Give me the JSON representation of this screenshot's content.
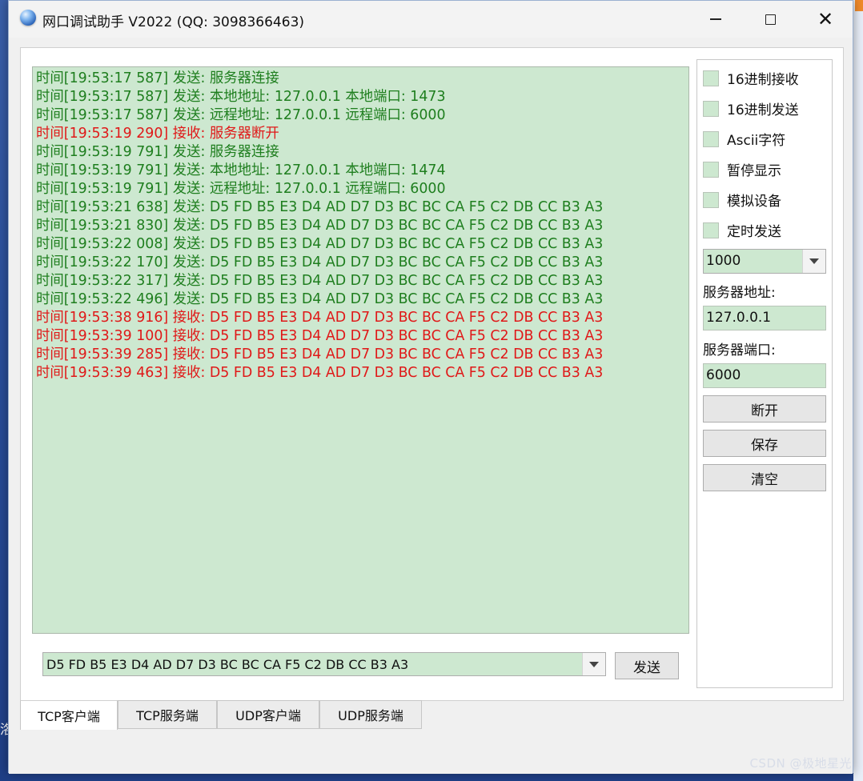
{
  "window": {
    "title": "网口调试助手 V2022 (QQ: 3098366463)",
    "minimize_icon": "minimize-icon",
    "maximize_icon": "maximize-icon",
    "close_icon": "close-icon",
    "close_glyph": "✕"
  },
  "log": [
    {
      "kind": "send",
      "text": "时间[19:53:17 587] 发送: 服务器连接"
    },
    {
      "kind": "send",
      "text": "时间[19:53:17 587] 发送: 本地地址: 127.0.0.1  本地端口: 1473"
    },
    {
      "kind": "send",
      "text": "时间[19:53:17 587] 发送: 远程地址: 127.0.0.1  远程端口: 6000"
    },
    {
      "kind": "recv",
      "text": "时间[19:53:19 290] 接收: 服务器断开"
    },
    {
      "kind": "send",
      "text": "时间[19:53:19 791] 发送: 服务器连接"
    },
    {
      "kind": "send",
      "text": "时间[19:53:19 791] 发送: 本地地址: 127.0.0.1  本地端口: 1474"
    },
    {
      "kind": "send",
      "text": "时间[19:53:19 791] 发送: 远程地址: 127.0.0.1  远程端口: 6000"
    },
    {
      "kind": "send",
      "text": "时间[19:53:21 638] 发送: D5 FD B5 E3 D4 AD D7 D3 BC BC CA F5 C2 DB CC B3 A3"
    },
    {
      "kind": "send",
      "text": "时间[19:53:21 830] 发送: D5 FD B5 E3 D4 AD D7 D3 BC BC CA F5 C2 DB CC B3 A3"
    },
    {
      "kind": "send",
      "text": "时间[19:53:22 008] 发送: D5 FD B5 E3 D4 AD D7 D3 BC BC CA F5 C2 DB CC B3 A3"
    },
    {
      "kind": "send",
      "text": "时间[19:53:22 170] 发送: D5 FD B5 E3 D4 AD D7 D3 BC BC CA F5 C2 DB CC B3 A3"
    },
    {
      "kind": "send",
      "text": "时间[19:53:22 317] 发送: D5 FD B5 E3 D4 AD D7 D3 BC BC CA F5 C2 DB CC B3 A3"
    },
    {
      "kind": "send",
      "text": "时间[19:53:22 496] 发送: D5 FD B5 E3 D4 AD D7 D3 BC BC CA F5 C2 DB CC B3 A3"
    },
    {
      "kind": "recv",
      "text": "时间[19:53:38 916] 接收: D5 FD B5 E3 D4 AD D7 D3 BC BC CA F5 C2 DB CC B3 A3"
    },
    {
      "kind": "recv",
      "text": "时间[19:53:39 100] 接收: D5 FD B5 E3 D4 AD D7 D3 BC BC CA F5 C2 DB CC B3 A3"
    },
    {
      "kind": "recv",
      "text": "时间[19:53:39 285] 接收: D5 FD B5 E3 D4 AD D7 D3 BC BC CA F5 C2 DB CC B3 A3"
    },
    {
      "kind": "recv",
      "text": "时间[19:53:39 463] 接收: D5 FD B5 E3 D4 AD D7 D3 BC BC CA F5 C2 DB CC B3 A3"
    }
  ],
  "send_input": {
    "value": "D5 FD B5 E3 D4 AD D7 D3 BC BC CA F5 C2 DB CC B3 A3"
  },
  "send_button": "发送",
  "options": {
    "hex_receive": "16进制接收",
    "hex_send": "16进制发送",
    "ascii": "Ascii字符",
    "pause_display": "暂停显示",
    "simulate_device": "模拟设备",
    "timed_send": "定时发送"
  },
  "interval": "1000",
  "server_address_label": "服务器地址:",
  "server_address": "127.0.0.1",
  "server_port_label": "服务器端口:",
  "server_port": "6000",
  "buttons": {
    "disconnect": "断开",
    "save": "保存",
    "clear": "清空"
  },
  "tabs": [
    "TCP客户端",
    "TCP服务端",
    "UDP客户端",
    "UDP服务端"
  ],
  "active_tab": "TCP客户端",
  "colors": {
    "send_text": "#1e7e1e",
    "recv_text": "#e01818",
    "field_bg": "#cde8d0"
  },
  "desktop": {
    "left_fragment": "洛",
    "watermark": "CSDN @极地星光"
  }
}
